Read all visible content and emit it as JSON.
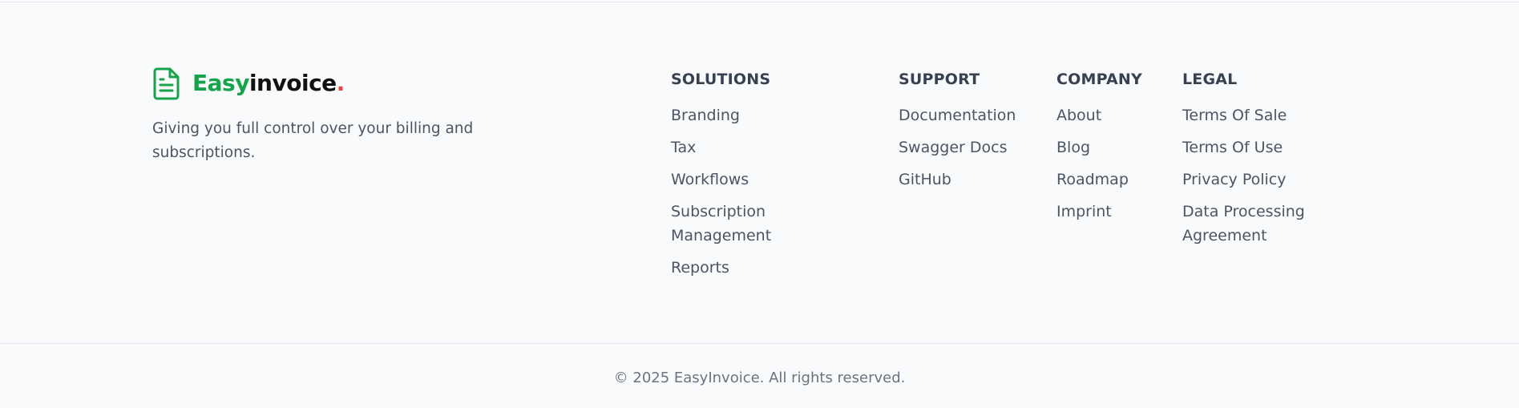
{
  "brand": {
    "logo_icon": "document-icon",
    "name_part1": "Easy",
    "name_part2": "invoice",
    "name_dot": ".",
    "tagline": "Giving you full control over your billing and subscriptions.",
    "colors": {
      "accent": "#16a34a",
      "dot": "#ef4444",
      "text": "#111111"
    }
  },
  "columns": {
    "solutions": {
      "heading": "SOLUTIONS",
      "items": [
        "Branding",
        "Tax",
        "Workflows",
        "Subscription Management",
        "Reports"
      ]
    },
    "support": {
      "heading": "SUPPORT",
      "items": [
        "Documentation",
        "Swagger Docs",
        "GitHub"
      ]
    },
    "company": {
      "heading": "COMPANY",
      "items": [
        "About",
        "Blog",
        "Roadmap",
        "Imprint"
      ]
    },
    "legal": {
      "heading": "LEGAL",
      "items": [
        "Terms Of Sale",
        "Terms Of Use",
        "Privacy Policy",
        "Data Processing Agreement"
      ]
    }
  },
  "footer": {
    "copyright": "© 2025 EasyInvoice. All rights reserved."
  }
}
